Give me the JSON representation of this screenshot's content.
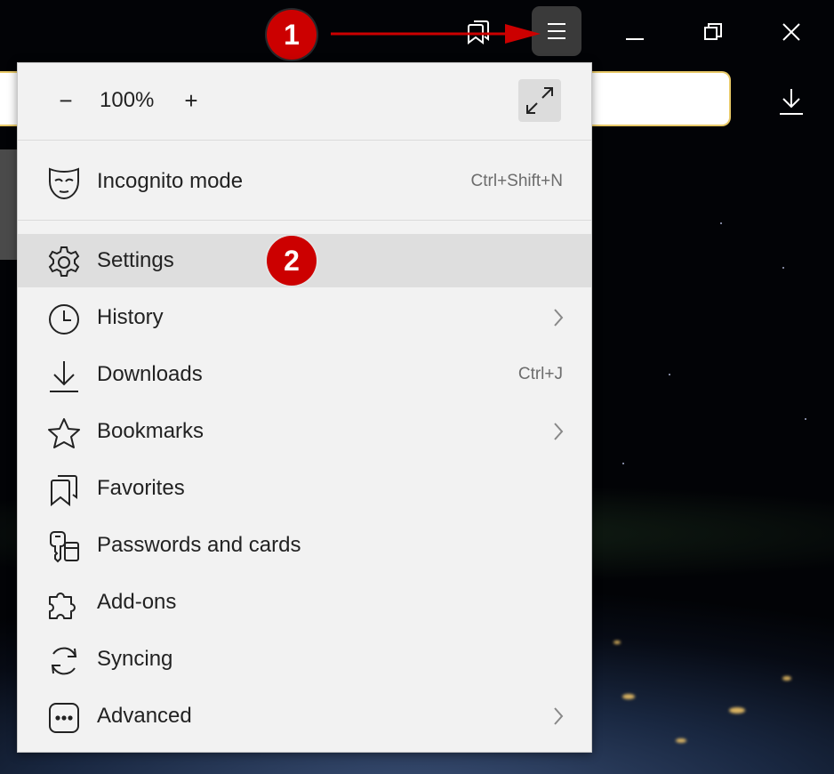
{
  "toolbar": {
    "bookmarks_icon": "bookmarks-icon",
    "menu_icon": "hamburger-icon",
    "minimize_icon": "minimize-icon",
    "restore_icon": "restore-icon",
    "close_icon": "close-icon",
    "download_icon": "download-icon"
  },
  "callouts": {
    "step1": "1",
    "step2": "2",
    "color": "#c00000"
  },
  "menu": {
    "zoom": {
      "minus_label": "−",
      "value": "100%",
      "plus_label": "+"
    },
    "items": [
      {
        "label": "Incognito mode",
        "shortcut": "Ctrl+Shift+N",
        "icon": "mask-icon"
      },
      {
        "label": "Settings",
        "icon": "gear-icon",
        "highlighted": true
      },
      {
        "label": "History",
        "icon": "clock-icon",
        "submenu": true
      },
      {
        "label": "Downloads",
        "shortcut": "Ctrl+J",
        "icon": "download-icon"
      },
      {
        "label": "Bookmarks",
        "icon": "star-icon",
        "submenu": true
      },
      {
        "label": "Favorites",
        "icon": "favorites-icon"
      },
      {
        "label": "Passwords and cards",
        "icon": "key-card-icon"
      },
      {
        "label": "Add-ons",
        "icon": "puzzle-icon"
      },
      {
        "label": "Syncing",
        "icon": "sync-icon"
      },
      {
        "label": "Advanced",
        "icon": "more-icon",
        "submenu": true
      }
    ]
  },
  "colors": {
    "menu_bg": "#f2f2f2",
    "highlight": "#dedede",
    "address_border": "#e8c968",
    "menu_button_bg": "#3a3a3a"
  }
}
